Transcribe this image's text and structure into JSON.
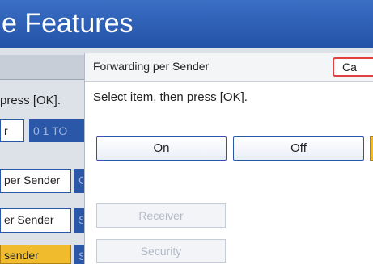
{
  "window": {
    "title": "e Features"
  },
  "background": {
    "instruction_fragment": "press [OK].",
    "row1": {
      "left_label": "r",
      "right_label": "0 1 TO"
    },
    "items": [
      {
        "label": "per Sender",
        "tab": "C"
      },
      {
        "label": "er Sender",
        "tab": "S"
      },
      {
        "label": "sender",
        "tab": "S"
      }
    ]
  },
  "dialog": {
    "title": "Forwarding per Sender",
    "cancel_label": "Ca",
    "instruction": "Select item, then press [OK].",
    "options": {
      "on": "On",
      "off": "Off"
    },
    "disabled_buttons": {
      "receiver": "Receiver",
      "security": "Security"
    }
  },
  "colors": {
    "title_bar": "#2b5cb8",
    "accent_blue": "#2b57a8",
    "selected": "#f0bc2e",
    "cancel_border": "#e04040"
  }
}
